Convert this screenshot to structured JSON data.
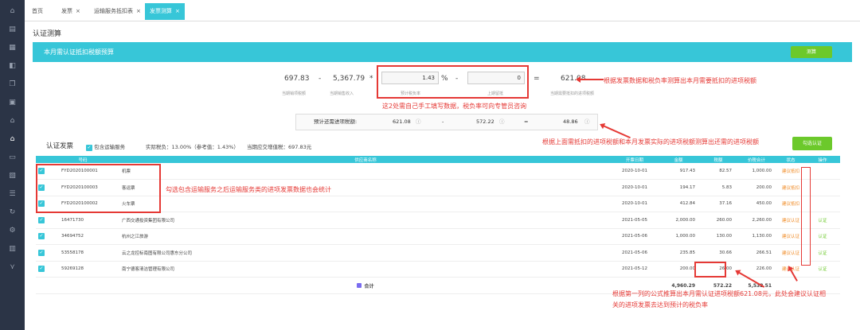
{
  "tabs": [
    {
      "label": "首页",
      "closable": false
    },
    {
      "label": "发票",
      "closable": true
    },
    {
      "label": "运输服务抵扣表",
      "closable": true
    },
    {
      "label": "发票测算",
      "closable": true,
      "active": true
    }
  ],
  "page_title": "认证测算",
  "panel_title": "本月需认证抵扣税额预算",
  "measure_button": "测算",
  "calc": {
    "v1": "697.83",
    "op1": "-",
    "v2": "5,367.79",
    "op2": "*",
    "rate": "1.43",
    "pct": "%",
    "op3": "-",
    "last": "0",
    "eq": "=",
    "result": "621.08",
    "labels": [
      "当期销项税额",
      "当期销售收入",
      "预计税负率",
      "上期留抵",
      "当期需要抵扣的进项税额"
    ]
  },
  "need_row": {
    "label": "预计还需进项税额:",
    "a": "621.08",
    "op": "-",
    "b": "572.22",
    "eq": "=",
    "c": "48.86"
  },
  "section_title": "认证发票",
  "option_label": "包含运输服务",
  "actual_rate": "实际税负：13.00%（参考值：1.43%）",
  "current_tax": "当期应交增值税：697.83元",
  "cert_button": "勾选认证",
  "table": {
    "headers": [
      "",
      "号码",
      "供应商名称",
      "开票日期",
      "金额",
      "税额",
      "价税合计",
      "状态",
      "操作"
    ],
    "rows": [
      {
        "checked": true,
        "no": "FYD2020100001",
        "supplier": "机票",
        "date": "2020-10-01",
        "amount": "917.43",
        "tax": "82.57",
        "total": "1,000.00",
        "status": "建议抵扣",
        "action": ""
      },
      {
        "checked": true,
        "no": "FYD2020100003",
        "supplier": "客运票",
        "date": "2020-10-01",
        "amount": "194.17",
        "tax": "5.83",
        "total": "200.00",
        "status": "建议抵扣",
        "action": ""
      },
      {
        "checked": true,
        "no": "FYD2020100002",
        "supplier": "火车票",
        "date": "2020-10-01",
        "amount": "412.84",
        "tax": "37.16",
        "total": "450.00",
        "status": "建议抵扣",
        "action": ""
      },
      {
        "checked": true,
        "no": "16471730",
        "supplier": "广西交通投资集团有限公司",
        "date": "2021-05-05",
        "amount": "2,000.00",
        "tax": "260.00",
        "total": "2,260.00",
        "status": "建议认证",
        "action": "认证"
      },
      {
        "checked": true,
        "no": "34694752",
        "supplier": "杭州之江旅游",
        "date": "2021-05-06",
        "amount": "1,000.00",
        "tax": "130.00",
        "total": "1,130.00",
        "status": "建议认证",
        "action": "认证"
      },
      {
        "checked": true,
        "no": "53558178",
        "supplier": "云之龙控标南图有限公司惠东分公司",
        "date": "2021-05-06",
        "amount": "235.85",
        "tax": "30.66",
        "total": "266.51",
        "status": "建议认证",
        "action": "认证"
      },
      {
        "checked": true,
        "no": "59269128",
        "supplier": "南宁德客清洁管理有限公司",
        "date": "2021-05-12",
        "amount": "200.00",
        "tax": "26.00",
        "total": "226.00",
        "status": "建议认证",
        "action": "认证"
      }
    ],
    "total_label": "合计",
    "total_amount": "4,960.29",
    "total_tax": "572.22",
    "total_sum": "5,532.51"
  },
  "annotations": {
    "a1": "根据发票数据和税负率测算出本月需要抵扣的进项税额",
    "a2": "这2处需自己手工填写数据，税负率可向专管员咨询",
    "a3": "根据上面需抵扣的进项税额和本月发票实际的进项税额测算出还需的进项税额",
    "a4": "勾选包含运输服务之后运输服务类的进项发票数据也会统计",
    "a5_line1": "根据第一列的公式推算出本月需认证进项税额621.08元，此处会建议认证相",
    "a5_line2": "关的进项发票去达到预计的税负率"
  },
  "colors": {
    "accent": "#37c6d8",
    "green": "#6cc92b",
    "red": "#e53935",
    "sidebar": "#2b3446"
  }
}
